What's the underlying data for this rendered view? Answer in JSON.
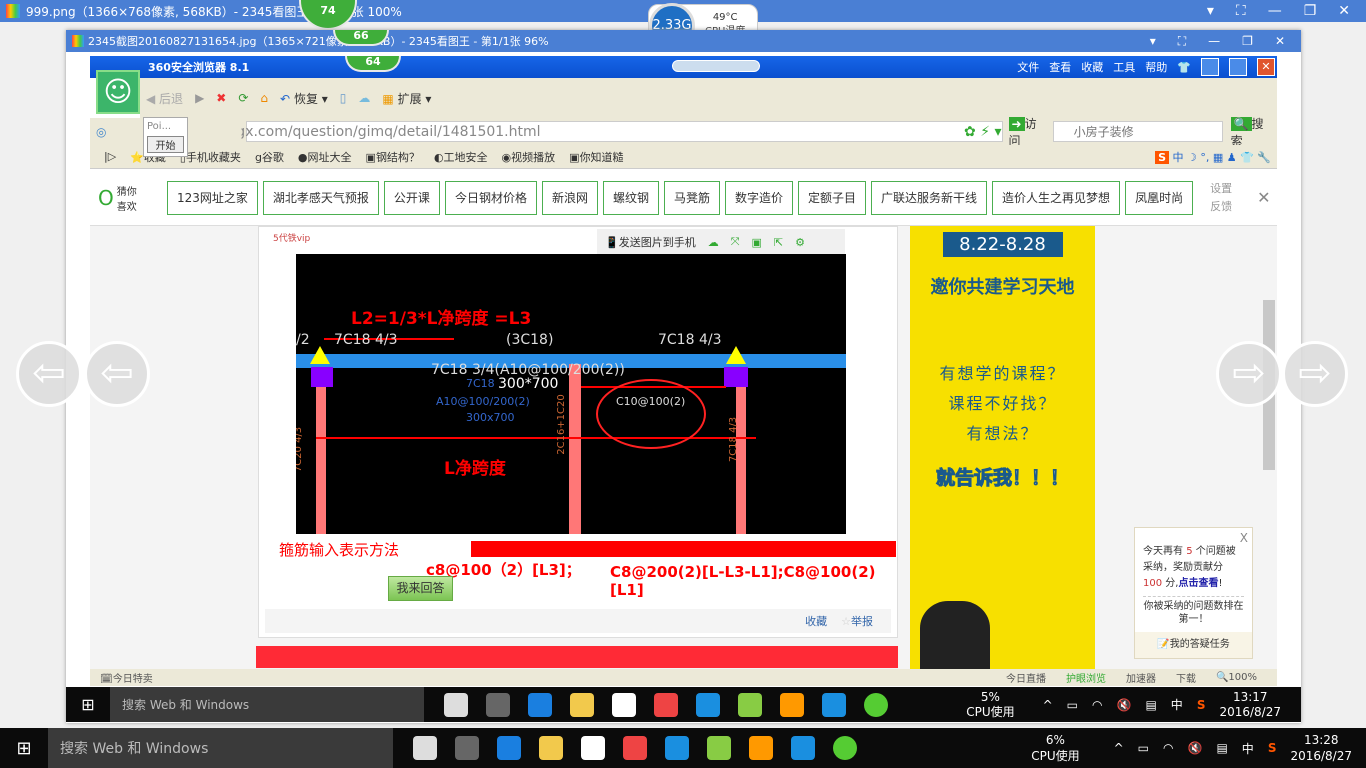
{
  "outer": {
    "title": "999.png（1366×768像素, 568KB）- 2345看图王 - 第1/1张 100%",
    "badge": "74"
  },
  "inner": {
    "title": "2345截图20160827131654.jpg（1365×721像素, 128KB）- 2345看图王 - 第1/1张 96%",
    "badge": "66"
  },
  "cpu_widget": {
    "speed": "2.33G",
    "temp": "49°C",
    "temp_label": "CPU温度"
  },
  "browser": {
    "title": "360安全浏览器 8.1",
    "badge": "64",
    "menu": [
      "文件",
      "查看",
      "收藏",
      "工具",
      "帮助"
    ],
    "toolbar": {
      "back": "后退",
      "restore": "恢复",
      "extend": "扩展"
    },
    "tooltip": {
      "text": "Poi...",
      "button": "开始"
    },
    "url": "http://www.fwxgx.com/question/gimq/detail/1481501.html",
    "visit": "访问",
    "search_placeholder": "小房子装修",
    "search_button": "搜索",
    "bookmarks": [
      "收藏",
      "手机收藏夹",
      "谷歌",
      "网址大全",
      "钢结构？",
      "工地安全",
      "视频播放",
      "你知道糙"
    ],
    "guess": "猜你喜欢",
    "nav": [
      "123网址之家",
      "湖北孝感天气预报",
      "公开课",
      "今日钢材价格",
      "新浪网",
      "螺纹钢",
      "马凳筋",
      "数字造价",
      "定额子目",
      "广联达服务新干线",
      "造价人生之再见梦想",
      "凤凰时尚"
    ],
    "nav_settings": [
      "设置",
      "反馈"
    ],
    "status": {
      "left": "今日特卖",
      "live": "今日直播",
      "fullscreen": "护眼浏览",
      "accel": "加速器",
      "download": "下载",
      "zoom": "100%"
    }
  },
  "content": {
    "vip": "5代铁vip",
    "img_tools": {
      "send": "发送图片到手机"
    },
    "drawing": {
      "l2": "L2=1/3*L净跨度 =L3",
      "lnet": "L净跨度",
      "t1": "7C18 4/3",
      "t2": "(3C18)",
      "t3": "7C18 4/3",
      "t4": "7C18 3/4(A10@100/200(2))",
      "t5": "300*700",
      "t6": "7C18",
      "t7": "A10@100/200(2)",
      "t8": "300x700",
      "t9": "C10@100(2)",
      "t10": "7C20 4/3",
      "t11": "2C16+1C20",
      "t12": "7C18 4/3",
      "t13": "/2"
    },
    "caption": "箍筋输入表示方法",
    "formula1": "c8@100（2）[L3]；",
    "formula2": "C8@200(2)[L-L3-L1];C8@100(2)[L1]",
    "answer_button": "我来回答",
    "collect": "收藏",
    "report": "举报"
  },
  "ad": {
    "date": "8.22-8.28",
    "headline": "邀你共建学习天地",
    "lines": [
      "有想学的课程？",
      "课程不好找？",
      "有想法？"
    ],
    "cta": "就告诉我！！！"
  },
  "popup": {
    "close": "X",
    "l1a": "今天再有",
    "count": "5",
    "l1b": "个问题被采纳，奖励贡献分",
    "points": "100",
    "l2": "分,",
    "link": "点击查看",
    "excl": "!",
    "l3": "你被采纳的问题数排在第一！",
    "task": "我的答疑任务"
  },
  "taskbar_inner": {
    "search": "搜索 Web 和 Windows",
    "cpu": "5%",
    "cpu_label": "CPU使用",
    "ime": "中",
    "time": "13:17",
    "date": "2016/8/27"
  },
  "taskbar_outer": {
    "search": "搜索 Web 和 Windows",
    "cpu": "6%",
    "cpu_label": "CPU使用",
    "ime": "中",
    "time": "13:28",
    "date": "2016/8/27"
  }
}
